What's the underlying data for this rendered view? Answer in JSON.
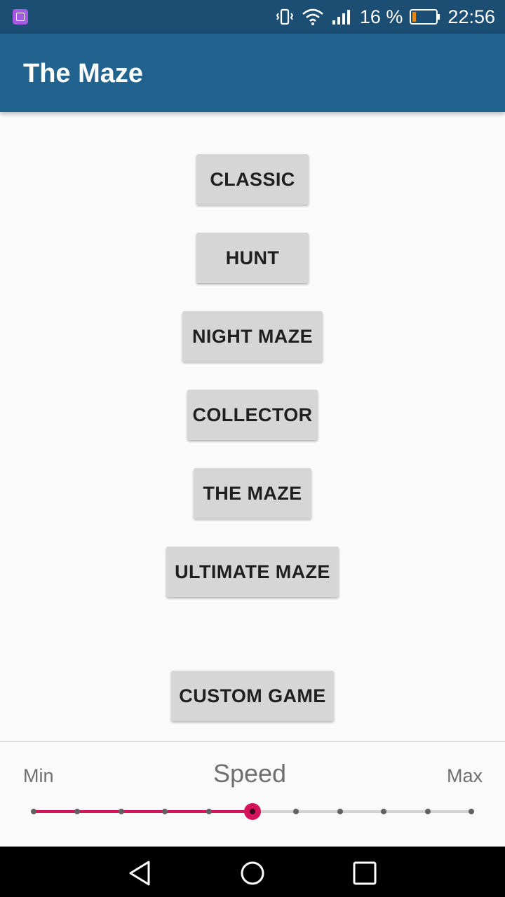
{
  "status_bar": {
    "battery_percent": "16 %",
    "time": "22:56",
    "battery_level": 0.16,
    "icons": [
      "gallery-notification-icon",
      "vibrate-icon",
      "wifi-icon",
      "signal-icon",
      "battery-icon"
    ]
  },
  "app_bar": {
    "title": "The Maze"
  },
  "modes": {
    "classic": "CLASSIC",
    "hunt": "HUNT",
    "night_maze": "NIGHT MAZE",
    "collector": "COLLECTOR",
    "the_maze": "THE MAZE",
    "ultimate_maze": "ULTIMATE MAZE",
    "custom_game": "CUSTOM GAME"
  },
  "speed": {
    "label": "Speed",
    "min_label": "Min",
    "max_label": "Max",
    "steps": 11,
    "value_index": 5
  },
  "colors": {
    "status_bar": "#1c4d72",
    "app_bar": "#21628f",
    "accent": "#d4145a",
    "button": "#d6d6d6"
  },
  "nav_bar": {
    "icons": [
      "back-icon",
      "home-icon",
      "recents-icon"
    ]
  }
}
